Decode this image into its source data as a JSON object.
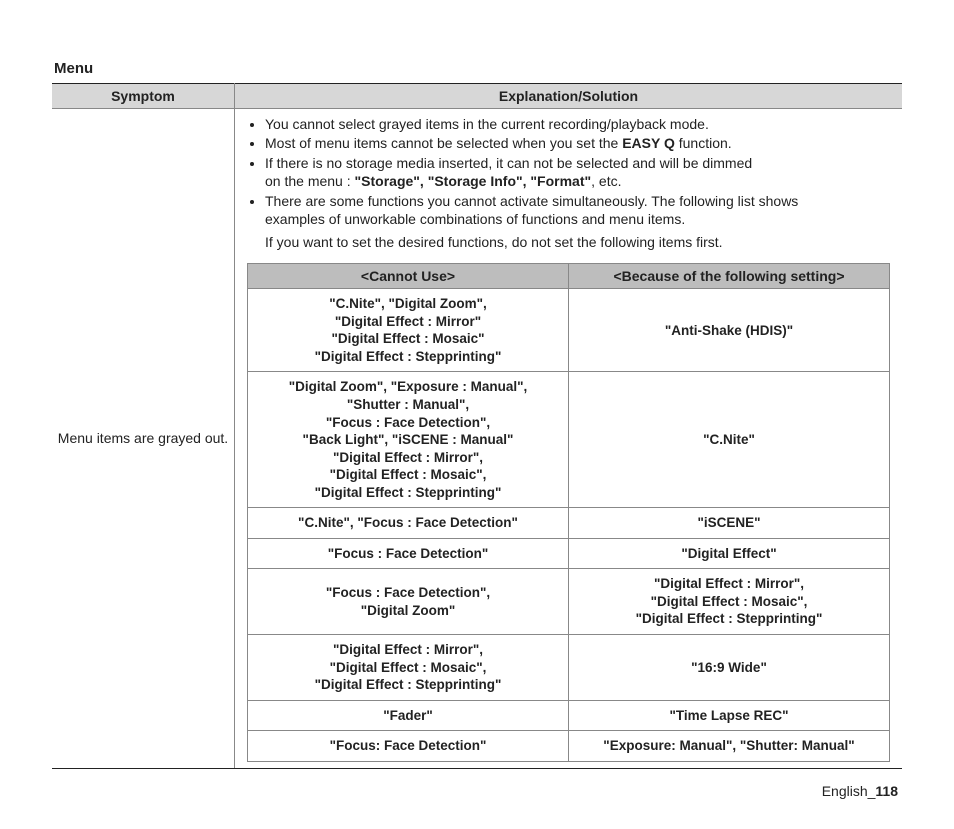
{
  "section_title": "Menu",
  "headers": {
    "symptom": "Symptom",
    "explanation": "Explanation/Solution"
  },
  "symptom": "Menu items are grayed out.",
  "bullets": {
    "b1": "You cannot select grayed items in the current recording/playback mode.",
    "b2_pre": "Most of menu items cannot be selected when you set the ",
    "b2_bold": "EASY Q",
    "b2_post": " function.",
    "b3_line1": "If there is no storage media inserted, it can not be selected and will be dimmed",
    "b3_line2_pre": "on the menu : ",
    "b3_line2_bold": "\"Storage\", \"Storage Info\", \"Format\"",
    "b3_line2_post": ", etc.",
    "b4_line1": "There are some functions you cannot activate simultaneously. The following list shows",
    "b4_line2": "examples of unworkable combinations of functions and menu items.",
    "after": "If you want to set the desired functions, do not set the following items first."
  },
  "inner_headers": {
    "cannot": "<Cannot Use>",
    "because": "<Because of the following setting>"
  },
  "rows": {
    "r1a": "\"C.Nite\", \"Digital Zoom\",\n\"Digital Effect : Mirror\"\n\"Digital Effect : Mosaic\"\n\"Digital Effect : Stepprinting\"",
    "r1b": "\"Anti-Shake (HDIS)\"",
    "r2a": "\"Digital Zoom\", \"Exposure : Manual\",\n\"Shutter : Manual\",\n\"Focus : Face Detection\",\n\"Back Light\", \"iSCENE : Manual\"\n\"Digital Effect : Mirror\",\n\"Digital Effect : Mosaic\",\n\"Digital Effect : Stepprinting\"",
    "r2b": "\"C.Nite\"",
    "r3a": "\"C.Nite\", \"Focus : Face Detection\"",
    "r3b": "\"iSCENE\"",
    "r4a": "\"Focus : Face Detection\"",
    "r4b": "\"Digital Effect\"",
    "r5a": "\"Focus : Face Detection\",\n\"Digital Zoom\"",
    "r5b": "\"Digital Effect : Mirror\",\n\"Digital Effect : Mosaic\",\n\"Digital Effect : Stepprinting\"",
    "r6a": "\"Digital Effect : Mirror\",\n\"Digital Effect : Mosaic\",\n\"Digital Effect : Stepprinting\"",
    "r6b": "\"16:9 Wide\"",
    "r7a": "\"Fader\"",
    "r7b": "\"Time Lapse REC\"",
    "r8a": "\"Focus: Face Detection\"",
    "r8b": "\"Exposure: Manual\",  \"Shutter: Manual\""
  },
  "footer": {
    "lang": "English_",
    "page": "118"
  }
}
